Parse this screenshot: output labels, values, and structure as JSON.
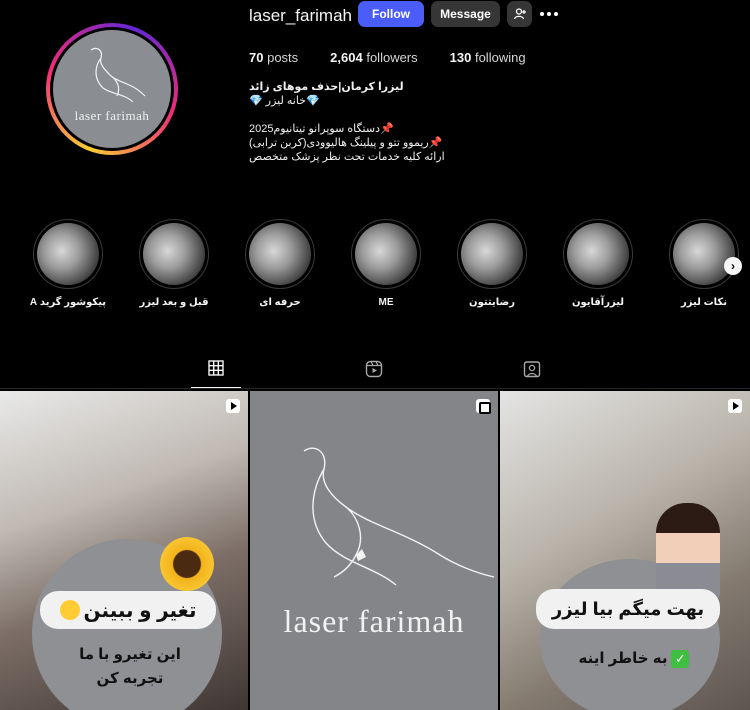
{
  "profile": {
    "username": "laser_farimah",
    "follow_label": "Follow",
    "message_label": "Message",
    "avatar_logo_text": "laser farimah",
    "stats": {
      "posts_count": "70",
      "posts_label": "posts",
      "followers_count": "2,604",
      "followers_label": "followers",
      "following_count": "130",
      "following_label": "following"
    },
    "bio": {
      "name": "لیزرا کرمان|حذف موهای زائد",
      "line1": "💎خانه لیزر 💎",
      "line2": "📌دستگاه سوپرانو تیتانیوم2025",
      "line3": "📌ریموو تتو و پیلینگ هالیوودی(کربن ترابی)",
      "line4": "ارائه کلیه خدمات تحت نظر پزشک متخصص"
    }
  },
  "highlights": [
    {
      "label": "پیکوشور گرید A"
    },
    {
      "label": "قبل و بعد لیزر"
    },
    {
      "label": "حرفه ای"
    },
    {
      "label": "ME"
    },
    {
      "label": "رضایتتون"
    },
    {
      "label": "لیزرآقایون"
    },
    {
      "label": "نکات لیزر"
    }
  ],
  "tabs": [
    {
      "name": "posts",
      "icon": "grid-icon",
      "active": true
    },
    {
      "name": "reels",
      "icon": "reels-icon",
      "active": false
    },
    {
      "name": "tagged",
      "icon": "tagged-icon",
      "active": false
    }
  ],
  "posts": [
    {
      "type": "reel",
      "pill_text": "تغیر و ببینن",
      "caption": "این تغیرو با ما تجربه کن"
    },
    {
      "type": "album",
      "logo_text": "laser farimah"
    },
    {
      "type": "reel",
      "pill_text": "بهت میگم بیا لیزر",
      "caption": "به خاطر اینه"
    }
  ],
  "colors": {
    "background": "#000000",
    "follow_button": "#4a5df9",
    "secondary_button": "#363636",
    "text": "#f5f5f5"
  }
}
